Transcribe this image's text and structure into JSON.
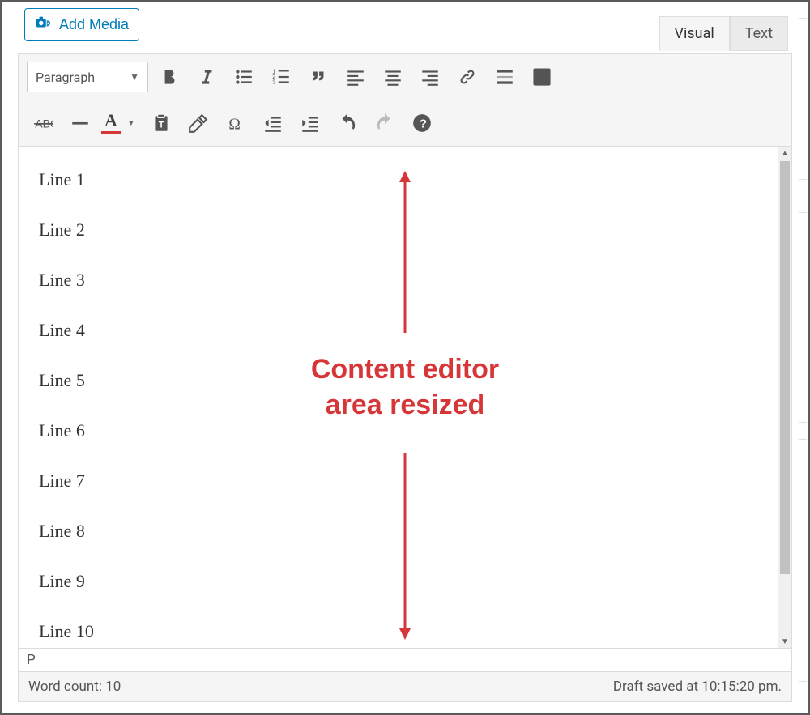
{
  "mediaButton": {
    "label": "Add Media"
  },
  "tabs": {
    "visual": "Visual",
    "text": "Text",
    "active": "visual"
  },
  "formatSelect": {
    "value": "Paragraph"
  },
  "content": {
    "lines": [
      "Line 1",
      "Line 2",
      "Line 3",
      "Line 4",
      "Line 5",
      "Line 6",
      "Line 7",
      "Line 8",
      "Line 9",
      "Line 10"
    ]
  },
  "pathBar": {
    "value": "P"
  },
  "statusBar": {
    "wordCountLabel": "Word count: 10",
    "saveStatus": "Draft saved at 10:15:20 pm."
  },
  "annotation": {
    "line1": "Content editor",
    "line2": "area resized"
  }
}
